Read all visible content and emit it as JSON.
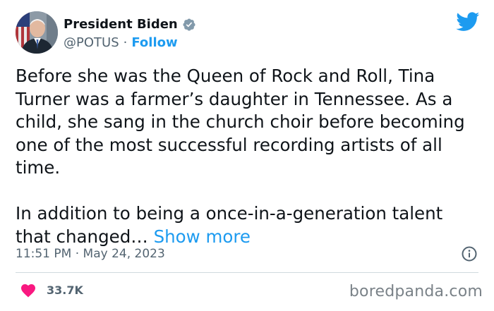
{
  "author": {
    "name": "President Biden",
    "handle": "@POTUS",
    "separator": "·",
    "follow_label": "Follow"
  },
  "tweet": {
    "paragraph1": "Before she was the Queen of Rock and Roll, Tina Turner was a farmer’s daughter in Tennessee. As a child, she sang in the church choir before becoming one of the most successful recording artists of all time.",
    "paragraph2": "In addition to being a once-in-a-generation talent that changed…",
    "show_more_label": "Show more"
  },
  "meta": {
    "timestamp": "11:51 PM · May 24, 2023"
  },
  "engagement": {
    "likes": "33.7K"
  },
  "watermark": "boredpanda.com",
  "icons": {
    "verified": "verified-badge-icon",
    "brand": "twitter-bird-icon",
    "info": "info-icon",
    "like": "heart-icon"
  },
  "colors": {
    "accent": "#1d9bf0",
    "heart": "#f91880",
    "text": "#0f1419",
    "secondary": "#536471"
  }
}
